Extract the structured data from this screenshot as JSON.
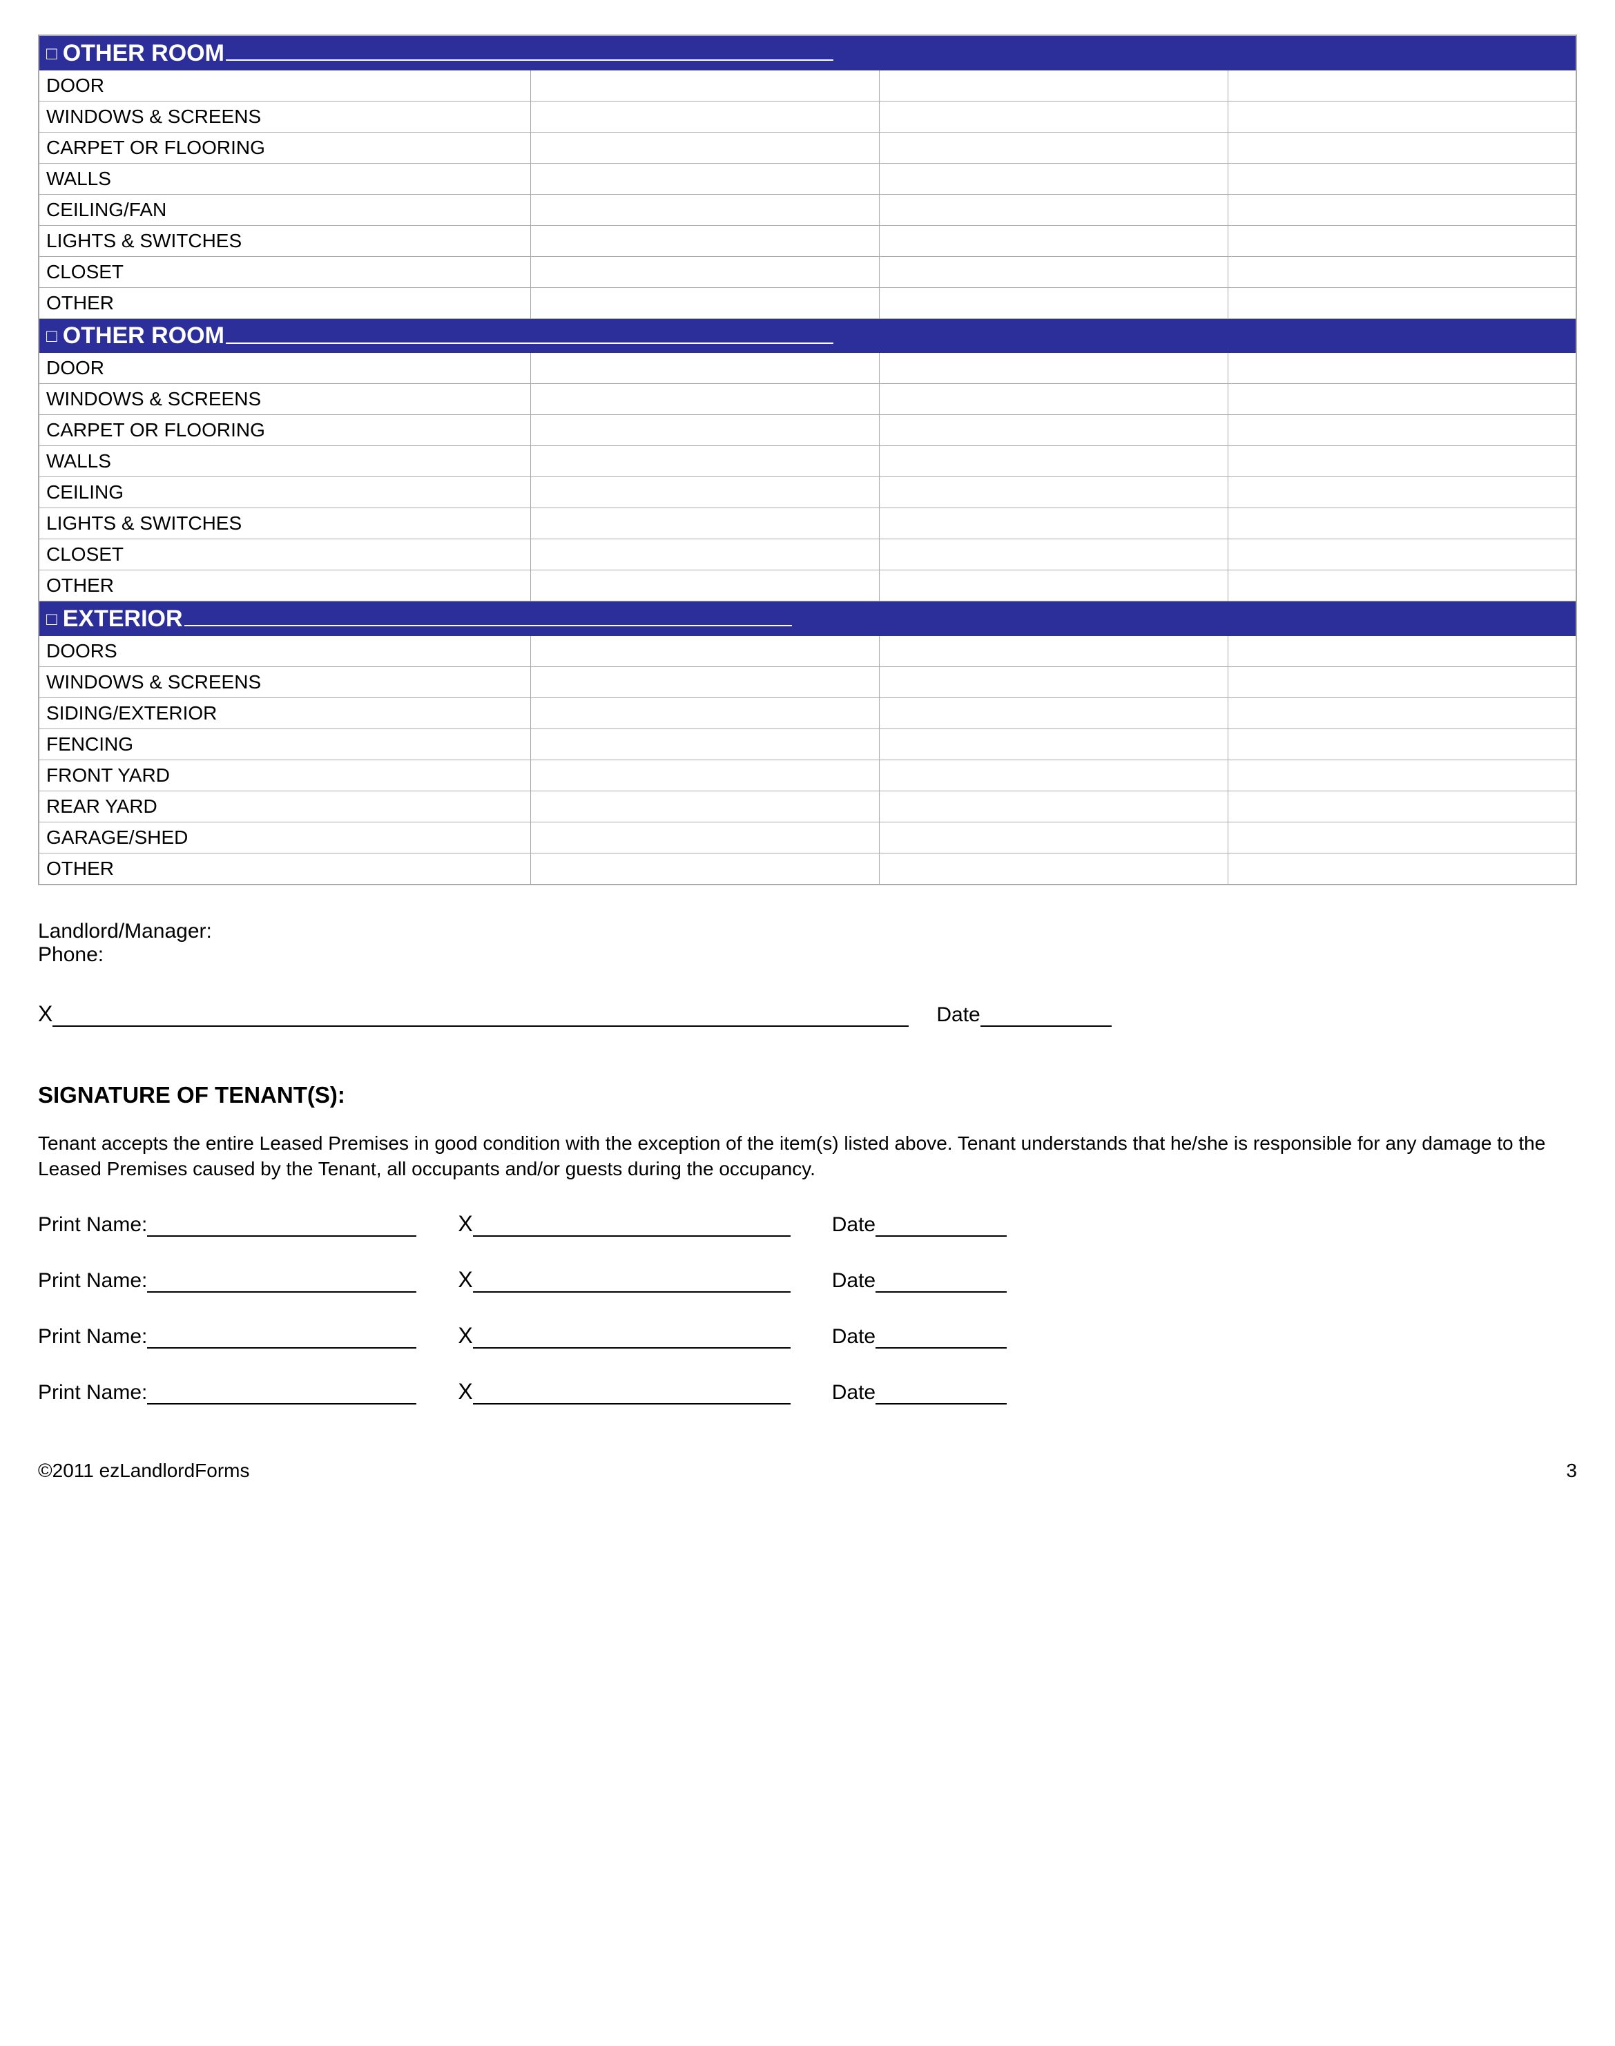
{
  "sections": [
    {
      "title": "OTHER ROOM",
      "items": [
        "DOOR",
        "WINDOWS & SCREENS",
        "CARPET OR FLOORING",
        "WALLS",
        "CEILING/FAN",
        "LIGHTS & SWITCHES",
        "CLOSET",
        "OTHER"
      ]
    },
    {
      "title": "OTHER ROOM",
      "items": [
        "DOOR",
        "WINDOWS & SCREENS",
        "CARPET OR FLOORING",
        "WALLS",
        "CEILING",
        "LIGHTS & SWITCHES",
        "CLOSET",
        "OTHER"
      ]
    },
    {
      "title": "EXTERIOR",
      "items": [
        "DOORS",
        "WINDOWS & SCREENS",
        "SIDING/EXTERIOR",
        "FENCING",
        "FRONT YARD",
        "REAR YARD",
        "GARAGE/SHED",
        "OTHER"
      ]
    }
  ],
  "landlord": {
    "label1": "Landlord/Manager:",
    "label2": "Phone:",
    "x": "X",
    "date": "Date"
  },
  "tenant": {
    "heading": "SIGNATURE OF TENANT(S):",
    "paragraph": "Tenant accepts the entire Leased Premises in good condition with the exception of the item(s) listed above. Tenant understands that he/she is responsible for any damage to the Leased Premises caused by the Tenant, all occupants and/or guests during the occupancy.",
    "printName": "Print Name:",
    "x": "X",
    "date": "Date",
    "rows": 4
  },
  "footer": {
    "copyright": "©2011 ezLandlordForms",
    "page": "3"
  },
  "checkbox_glyph": "□"
}
